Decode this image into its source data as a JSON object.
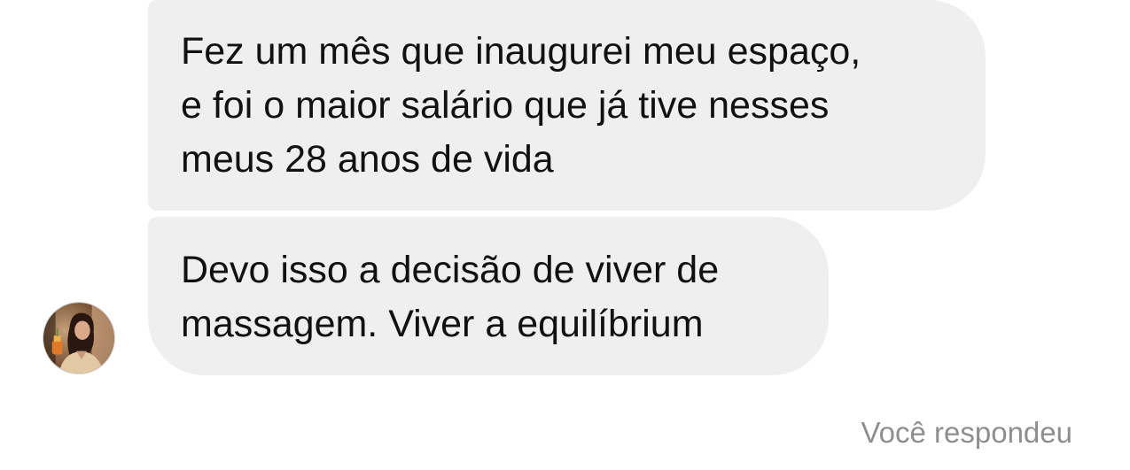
{
  "messages": [
    {
      "lines": [
        "Fez um mês que inaugurei meu espaço,",
        "e foi o maior salário que já tive nesses",
        "meus 28 anos de vida"
      ]
    },
    {
      "lines": [
        "Devo isso a decisão de viver de",
        "massagem. Viver a equilíbrium"
      ]
    }
  ],
  "sender": {
    "avatar_icon": "profile-photo-icon"
  },
  "reply_status": "Você respondeu",
  "colors": {
    "bubble_background": "#efefef",
    "message_text": "#111111",
    "status_text": "#8e8e8e",
    "page_background": "#ffffff"
  }
}
